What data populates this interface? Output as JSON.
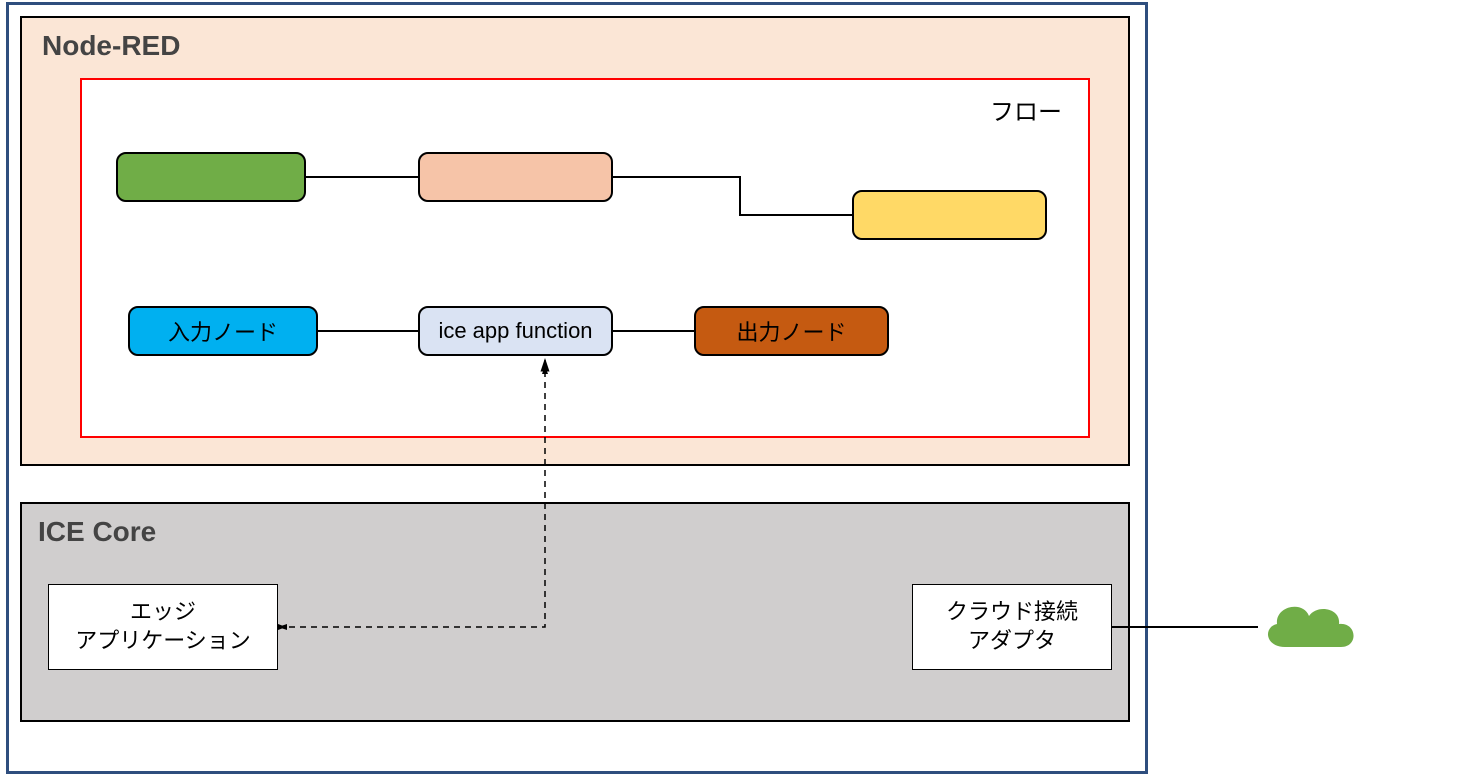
{
  "outer": {
    "node_red_title": "Node-RED",
    "flow_label": "フロー",
    "ice_core_title": "ICE Core"
  },
  "nodes": {
    "green": "",
    "peach": "",
    "yellow": "",
    "input_node": "入力ノード",
    "ice_app_function": "ice app function",
    "output_node": "出力ノード"
  },
  "boxes": {
    "edge_app_line1": "エッジ",
    "edge_app_line2": "アプリケーション",
    "cloud_adapter_line1": "クラウド接続",
    "cloud_adapter_line2": "アダプタ"
  },
  "colors": {
    "node_red_bg": "#FBE6D6",
    "green_node": "#70AD47",
    "peach_node": "#F6C4A8",
    "yellow_node": "#FFD966",
    "blue_node": "#00B0F0",
    "lightblue_node": "#DAE3F3",
    "brown_node": "#C55A11",
    "ice_core_bg": "#D0CECE",
    "flow_border": "#FF0000",
    "outer_border": "#2E4E7E",
    "cloud_fill": "#70AD47"
  }
}
